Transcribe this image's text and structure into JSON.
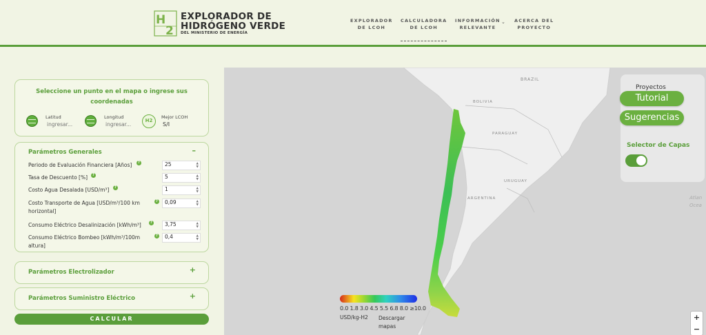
{
  "header": {
    "title_line1": "EXPLORADOR DE",
    "title_line2": "HIDRÓGENO VERDE",
    "subtitle": "DEL MINISTERIO DE ENERGÍA",
    "logo_text": "H2",
    "nav": [
      {
        "line1": "EXPLORADOR",
        "line2": "DE LCOH"
      },
      {
        "line1": "CALCULADORA",
        "line2": "DE LCOH"
      },
      {
        "line1": "INFORMACIÓN",
        "line2": "RELEVANTE"
      },
      {
        "line1": "ACERCA DEL",
        "line2": "PROYECTO"
      }
    ]
  },
  "coords": {
    "title": "Seleccione un punto en el mapa o ingrese sus coordenadas",
    "lat_label": "Latitud",
    "lat_placeholder": "ingresar...",
    "lon_label": "Longitud",
    "lon_placeholder": "ingresar...",
    "lcoh_label": "Mejor LCOH",
    "lcoh_value": "S/I"
  },
  "general": {
    "title": "Parámetros Generales",
    "toggle": "–",
    "params": [
      {
        "label": "Periodo de Evaluación Financiera [Años]",
        "value": "25"
      },
      {
        "label": "Tasa de Descuento [%]",
        "value": "5"
      },
      {
        "label": "Costo Agua Desalada [USD/m³]",
        "value": "1"
      },
      {
        "label": "Costo Transporte de Agua [USD/m³/100 km horizontal]",
        "value": "0,09"
      },
      {
        "label": "Consumo Eléctrico Desalinización [kWh/m³]",
        "value": "3,75"
      },
      {
        "label": "Consumo Eléctrico Bombeo [kWh/m³/100m altura]",
        "value": "0,4"
      }
    ]
  },
  "electrolyzer": {
    "title": "Parámetros Electrolizador",
    "toggle": "+"
  },
  "supply": {
    "title": "Parámetros Suministro Eléctrico",
    "toggle": "+"
  },
  "calculate_label": "CALCULAR",
  "map": {
    "labels": {
      "brazil": "BRAZIL",
      "bolivia": "BOLIVIA",
      "paraguay": "PARAGUAY",
      "uruguay": "URUGUAY",
      "argentina": "ARGENTINA",
      "atlantic_line1": "Atlan",
      "atlantic_line2": "Ocea"
    },
    "proyectos_label": "Proyectos",
    "tutorial_label": "Tutorial",
    "sugerencias_label": "Sugerencias",
    "selector_label": "Selector de Capas",
    "legend": {
      "ticks": "0.0 1.8 3.0 4.5 5.5 6.8 8.0 ≥10.0",
      "unit": "USD/kg-H2",
      "download_line1": "Descargar",
      "download_line2": "mapas"
    },
    "zoom_in": "+",
    "zoom_out": "−"
  },
  "colors": {
    "accent": "#5a9e3a",
    "bg": "#f1f4e4",
    "map_bg": "#d5d5d5",
    "land": "#f0f0f0"
  }
}
